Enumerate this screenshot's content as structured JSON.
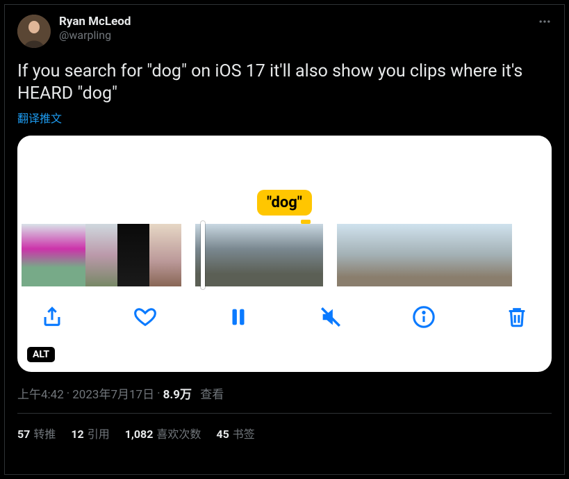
{
  "user": {
    "display_name": "Ryan McLeod",
    "handle": "@warpling"
  },
  "tweet_text": "If you search for \"dog\" on iOS 17 it'll also show you clips where it's HEARD \"dog\"",
  "translate_label": "翻译推文",
  "media": {
    "search_token": "\"dog\"",
    "alt_badge": "ALT"
  },
  "timestamp": {
    "time": "上午4:42",
    "date": "2023年7月17日",
    "separator": " · ",
    "views_number": "8.9万",
    "views_label": "查看"
  },
  "stats": {
    "retweets": {
      "count": "57",
      "label": "转推"
    },
    "quotes": {
      "count": "12",
      "label": "引用"
    },
    "likes": {
      "count": "1,082",
      "label": "喜欢次数"
    },
    "bookmarks": {
      "count": "45",
      "label": "书签"
    }
  }
}
